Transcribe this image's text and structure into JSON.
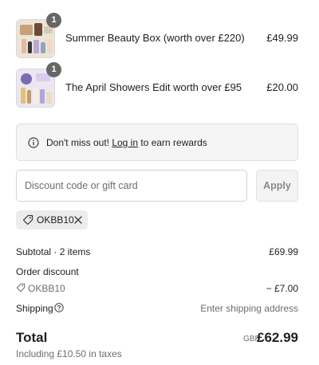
{
  "line_items": [
    {
      "quantity": "1",
      "name": "Summer Beauty Box (worth over £220)",
      "price": "£49.99"
    },
    {
      "quantity": "1",
      "name": "The April Showers Edit worth over £95",
      "price": "£20.00"
    }
  ],
  "rewards": {
    "prefix": "Don't miss out! ",
    "link": "Log in",
    "suffix": " to earn rewards",
    "icon": "info-icon"
  },
  "discount": {
    "placeholder": "Discount code or gift card",
    "value": "",
    "apply_label": "Apply"
  },
  "applied_code": {
    "code": "OKBB10",
    "tag_icon": "tag-icon",
    "remove_icon": "close-icon"
  },
  "summary": {
    "subtotal_label": "Subtotal · 2 items",
    "subtotal_value": "£69.99",
    "order_discount_label": "Order discount",
    "order_discount_code": "OKBB10",
    "order_discount_value": "− £7.00",
    "shipping_label": "Shipping",
    "shipping_value": "Enter shipping address"
  },
  "total": {
    "label": "Total",
    "currency": "GBP",
    "value": "£62.99",
    "tax_note": "Including £10.50 in taxes"
  },
  "colors": {
    "text": "#1f1f1f",
    "muted": "#6d6d6d",
    "badge": "#666666",
    "panel": "#f5f5f5",
    "chip": "#ececec"
  }
}
